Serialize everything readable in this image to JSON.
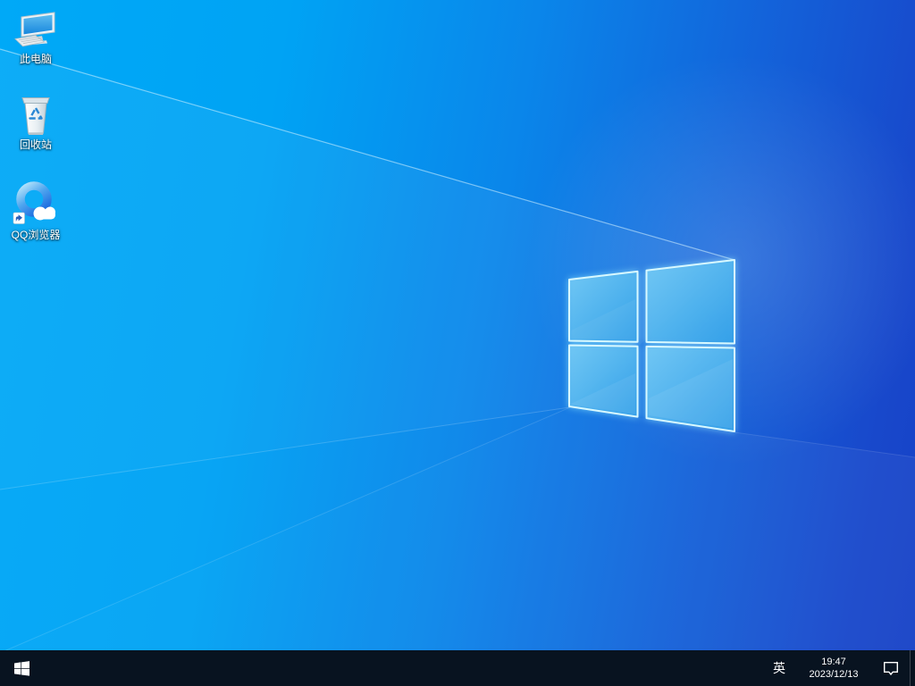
{
  "wallpaper": {
    "name": "windows-10-light-default",
    "colors": {
      "left": "#00a9f7",
      "mid": "#0a86ea",
      "right": "#1640c6",
      "logo_pane_light": "#73c8f4",
      "logo_pane_dark": "#2f9de7",
      "logo_border": "#d8f9ff"
    }
  },
  "desktop": {
    "icons": [
      {
        "id": "this-pc",
        "icon": "computer-monitor-icon",
        "label": "此电脑"
      },
      {
        "id": "recycle-bin",
        "icon": "recycle-bin-icon",
        "label": "回收站"
      },
      {
        "id": "qq-browser",
        "icon": "qq-browser-icon",
        "label": "QQ浏览器"
      }
    ]
  },
  "taskbar": {
    "background_color": "#081320",
    "icons": {
      "start": "windows-start-icon",
      "action_center": "action-center-icon"
    },
    "input_indicator": "英",
    "clock": {
      "time": "19:47",
      "date": "2023/12/13"
    }
  }
}
